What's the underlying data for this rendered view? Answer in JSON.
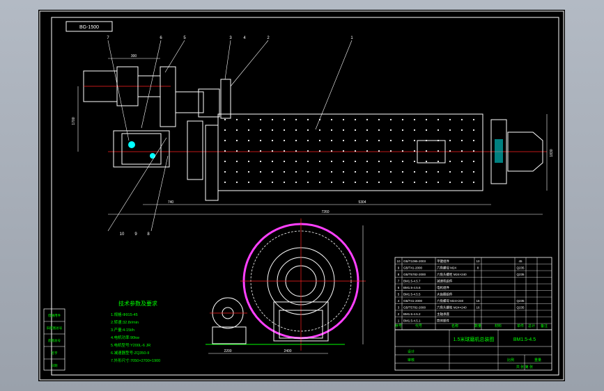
{
  "title_tag": "BG-1500",
  "callouts": [
    "7",
    "6",
    "5",
    "3",
    "4",
    "2",
    "1",
    "10",
    "9",
    "8"
  ],
  "dims": {
    "top_left": "300",
    "left_height": "1700",
    "bottom_a": "740",
    "bottom_b": "5304",
    "overall": "7260",
    "right_dia": "1830",
    "front_left": "2200",
    "front_right": "2400"
  },
  "tech": {
    "title": "技术参数及要求",
    "lines": [
      "1.规格:Φ915-45",
      "2.转速:32.8r/min",
      "3.产量:4-15t/h",
      "4.电机功率:90kw",
      "5.电机型号:Y200L-6 JR",
      "6.减速器型号:ZQ350-II",
      "7.外形尺寸:7050×2700×1900"
    ]
  },
  "bom": [
    {
      "no": "10",
      "code": "GB/T1095-2003",
      "name": "平键组件",
      "qty": "10",
      "mat": "",
      "mass": "45"
    },
    {
      "no": "9",
      "code": "GB/T41-2000",
      "name": "六角螺母 M24",
      "qty": "8",
      "mat": "",
      "mass": "Q235"
    },
    {
      "no": "8",
      "code": "GB/T5782-2000",
      "name": "六角头螺栓 M24×240",
      "qty": "",
      "mat": "",
      "mass": "Q235"
    },
    {
      "no": "7",
      "code": "BM1.5-4.5.7",
      "name": "减速机组件",
      "qty": "",
      "mat": "",
      "mass": ""
    },
    {
      "no": "6",
      "code": "BM1.5-4.5.6",
      "name": "电机组件",
      "qty": "",
      "mat": "",
      "mass": ""
    },
    {
      "no": "5",
      "code": "BM1.5-4.5.5",
      "name": "大齿圈组件",
      "qty": "",
      "mat": "",
      "mass": ""
    },
    {
      "no": "4",
      "code": "GB/T41-2000",
      "name": "六角螺母 M24×240",
      "qty": "16",
      "mat": "",
      "mass": "Q235"
    },
    {
      "no": "3",
      "code": "GB/T5782-2000",
      "name": "六角头螺栓 M24×240",
      "qty": "16",
      "mat": "",
      "mass": "Q235"
    },
    {
      "no": "2",
      "code": "BM1.5-4.5.2",
      "name": "主轴承座",
      "qty": "",
      "mat": "",
      "mass": ""
    },
    {
      "no": "1",
      "code": "BM1.5-4.5.1",
      "name": "筒体部件",
      "qty": "",
      "mat": "",
      "mass": ""
    }
  ],
  "bom_header": {
    "no": "序号",
    "code": "代号",
    "name": "名称",
    "qty": "数量",
    "mat": "材料",
    "single": "单件",
    "total": "总计",
    "note": "备注"
  },
  "title_block": {
    "drawing_name": "1.5米球磨机总装图",
    "drawing_no": "BM1.5-4.5",
    "design": "设计",
    "check": "审核",
    "scale": "比例",
    "weight": "重量",
    "sheet": "共 张 第 张"
  },
  "left_block": [
    "借通用件",
    "旧底图总号",
    "底图总号",
    "签字",
    "日期"
  ],
  "colors": {
    "background": "#000000",
    "lines": "#ffffff",
    "red": "#ff2020",
    "green": "#00ff00",
    "magenta": "#ff40ff",
    "cyan": "#00ffff",
    "yellow": "#ffff00"
  }
}
